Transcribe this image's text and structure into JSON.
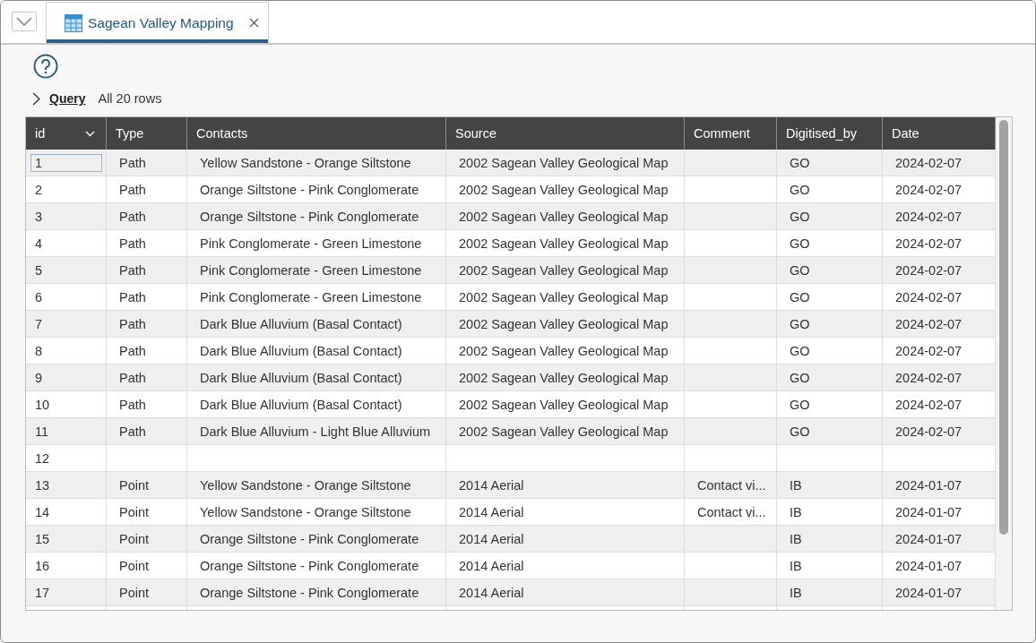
{
  "tab": {
    "title": "Sagean Valley Mapping",
    "selected": true
  },
  "query": {
    "label": "Query",
    "summary": "All 20 rows",
    "expanded": false
  },
  "table": {
    "columns": [
      {
        "label": "id",
        "sortable": true
      },
      {
        "label": "Type",
        "sortable": false
      },
      {
        "label": "Contacts",
        "sortable": false
      },
      {
        "label": "Source",
        "sortable": false
      },
      {
        "label": "Comment",
        "sortable": false
      },
      {
        "label": "Digitised_by",
        "sortable": false
      },
      {
        "label": "Date",
        "sortable": false
      }
    ],
    "rows": [
      {
        "focused": true,
        "cells": [
          "1",
          "Path",
          "Yellow Sandstone - Orange Siltstone",
          "2002 Sagean Valley Geological Map",
          "",
          "GO",
          "2024-02-07"
        ]
      },
      {
        "focused": false,
        "cells": [
          "2",
          "Path",
          "Orange Siltstone - Pink Conglomerate",
          "2002 Sagean Valley Geological Map",
          "",
          "GO",
          "2024-02-07"
        ]
      },
      {
        "focused": false,
        "cells": [
          "3",
          "Path",
          "Orange Siltstone - Pink Conglomerate",
          "2002 Sagean Valley Geological Map",
          "",
          "GO",
          "2024-02-07"
        ]
      },
      {
        "focused": false,
        "cells": [
          "4",
          "Path",
          "Pink Conglomerate - Green Limestone",
          "2002 Sagean Valley Geological Map",
          "",
          "GO",
          "2024-02-07"
        ]
      },
      {
        "focused": false,
        "cells": [
          "5",
          "Path",
          "Pink Conglomerate - Green Limestone",
          "2002 Sagean Valley Geological Map",
          "",
          "GO",
          "2024-02-07"
        ]
      },
      {
        "focused": false,
        "cells": [
          "6",
          "Path",
          "Pink Conglomerate - Green Limestone",
          "2002 Sagean Valley Geological Map",
          "",
          "GO",
          "2024-02-07"
        ]
      },
      {
        "focused": false,
        "cells": [
          "7",
          "Path",
          "Dark Blue Alluvium (Basal Contact)",
          "2002 Sagean Valley Geological Map",
          "",
          "GO",
          "2024-02-07"
        ]
      },
      {
        "focused": false,
        "cells": [
          "8",
          "Path",
          "Dark Blue Alluvium (Basal Contact)",
          "2002 Sagean Valley Geological Map",
          "",
          "GO",
          "2024-02-07"
        ]
      },
      {
        "focused": false,
        "cells": [
          "9",
          "Path",
          "Dark Blue Alluvium (Basal Contact)",
          "2002 Sagean Valley Geological Map",
          "",
          "GO",
          "2024-02-07"
        ]
      },
      {
        "focused": false,
        "cells": [
          "10",
          "Path",
          "Dark Blue Alluvium (Basal Contact)",
          "2002 Sagean Valley Geological Map",
          "",
          "GO",
          "2024-02-07"
        ]
      },
      {
        "focused": false,
        "cells": [
          "11",
          "Path",
          "Dark Blue Alluvium - Light Blue Alluvium",
          "2002 Sagean Valley Geological Map",
          "",
          "GO",
          "2024-02-07"
        ]
      },
      {
        "focused": false,
        "cells": [
          "12",
          "",
          "",
          "",
          "",
          "",
          ""
        ]
      },
      {
        "focused": false,
        "cells": [
          "13",
          "Point",
          "Yellow Sandstone - Orange Siltstone",
          "2014 Aerial",
          "Contact vi...",
          "IB",
          "2024-01-07"
        ]
      },
      {
        "focused": false,
        "cells": [
          "14",
          "Point",
          "Yellow Sandstone - Orange Siltstone",
          "2014 Aerial",
          "Contact vi...",
          "IB",
          "2024-01-07"
        ]
      },
      {
        "focused": false,
        "cells": [
          "15",
          "Point",
          "Orange Siltstone - Pink Conglomerate",
          "2014 Aerial",
          "",
          "IB",
          "2024-01-07"
        ]
      },
      {
        "focused": false,
        "cells": [
          "16",
          "Point",
          "Orange Siltstone - Pink Conglomerate",
          "2014 Aerial",
          "",
          "IB",
          "2024-01-07"
        ]
      },
      {
        "focused": false,
        "cells": [
          "17",
          "Point",
          "Orange Siltstone - Pink Conglomerate",
          "2014 Aerial",
          "",
          "IB",
          "2024-01-07"
        ]
      }
    ]
  }
}
